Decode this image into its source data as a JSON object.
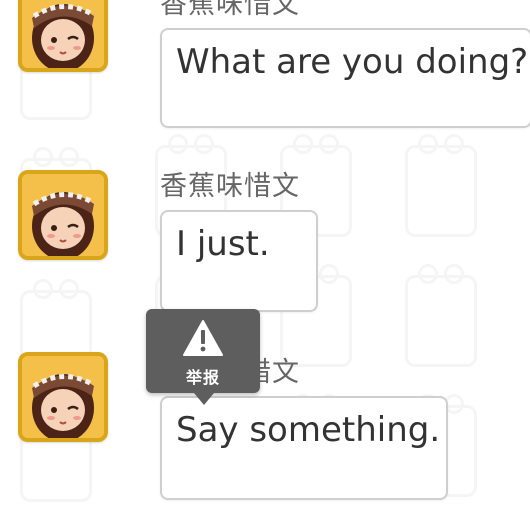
{
  "messages": [
    {
      "username": "香蕉味惜文",
      "text": "What are you doing?"
    },
    {
      "username": "香蕉味惜文",
      "text": "I just."
    },
    {
      "username": "香蕉味惜文",
      "text": "Say something."
    }
  ],
  "report_popup": {
    "icon": "warning-triangle-icon",
    "label": "举报"
  },
  "colors": {
    "avatar_border": "#d9a61a",
    "bubble_border": "#cfcfcf",
    "username": "#666666",
    "popup_bg": "#5e5e5e"
  }
}
